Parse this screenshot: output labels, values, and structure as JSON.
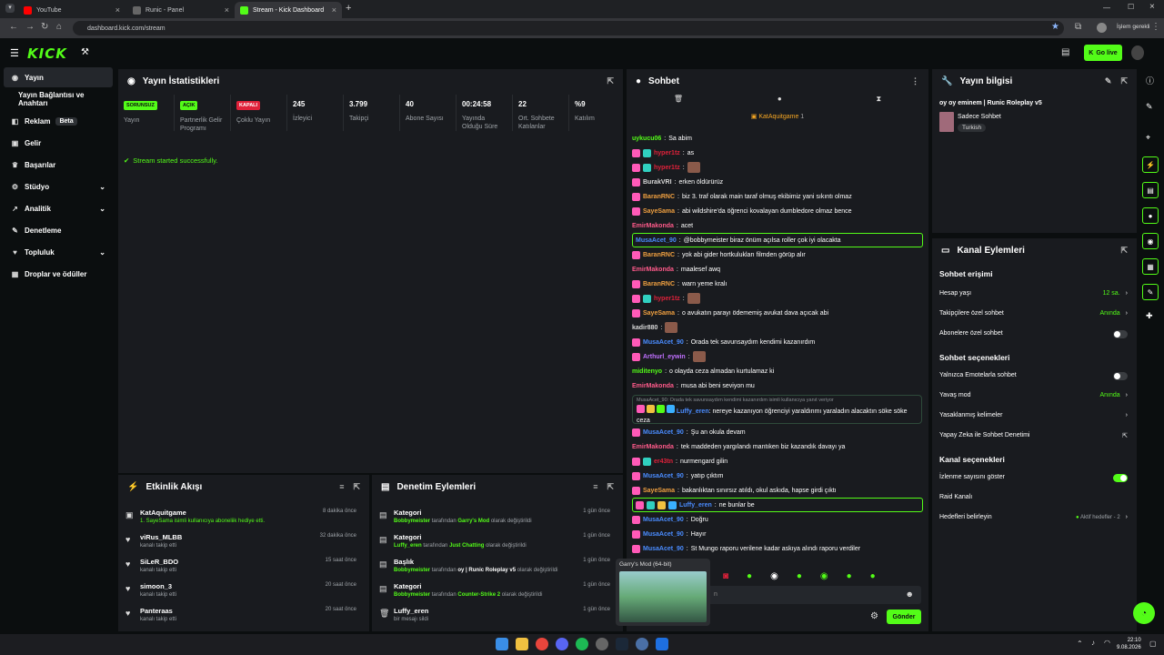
{
  "browser": {
    "tabs": [
      {
        "title": "YouTube",
        "color": "#ff0000"
      },
      {
        "title": "Runic - Panel",
        "color": "#888888"
      },
      {
        "title": "Stream - Kick Dashboard",
        "color": "#53fc18"
      }
    ],
    "url": "dashboard.kick.com/stream",
    "profile_label": "İşlem gerekli"
  },
  "topbar": {
    "logo": "KICK",
    "go_live": "Go live"
  },
  "sidebar": {
    "items": [
      {
        "label": "Yayın",
        "icon": "broadcast-icon"
      },
      {
        "label": "Yayın Bağlantısı ve Anahtarı",
        "icon": ""
      },
      {
        "label": "Reklam",
        "icon": "megaphone-icon",
        "badge": "Beta"
      },
      {
        "label": "Gelir",
        "icon": "money-icon"
      },
      {
        "label": "Başarılar",
        "icon": "trophy-icon"
      },
      {
        "label": "Stüdyo",
        "icon": "studio-icon"
      },
      {
        "label": "Analitik",
        "icon": "chart-icon"
      },
      {
        "label": "Denetleme",
        "icon": "shield-icon"
      },
      {
        "label": "Topluluk",
        "icon": "users-icon"
      },
      {
        "label": "Droplar ve ödüller",
        "icon": "gift-icon"
      }
    ]
  },
  "stats": {
    "title": "Yayın İstatistikleri",
    "items": [
      {
        "value": "SORUNSUZ",
        "label": "Yayın",
        "pill": "#53fc18",
        "pilltext": "#0b0e0f"
      },
      {
        "value": "AÇIK",
        "label": "Partnerlik Gelir Programı",
        "pill": "#53fc18",
        "pilltext": "#0b0e0f"
      },
      {
        "value": "KAPALI",
        "label": "Çoklu Yayın",
        "pill": "#e0213a",
        "pilltext": "#ffffff"
      },
      {
        "value": "245",
        "label": "İzleyici"
      },
      {
        "value": "3.799",
        "label": "Takipçi"
      },
      {
        "value": "40",
        "label": "Abone Sayısı"
      },
      {
        "value": "00:24:58",
        "label": "Yayında Olduğu Süre"
      },
      {
        "value": "22",
        "label": "Ort. Sohbete Katılanlar"
      },
      {
        "value": "%9",
        "label": "Katılım"
      }
    ],
    "success": "Stream started successfully."
  },
  "feed": {
    "title": "Etkinlik Akışı",
    "items": [
      {
        "name": "KatAquitgame",
        "sub": "1. SayeSama isimli kullanıcıya aboneliik hediye etti.",
        "time": "8 dakika önce",
        "icon": "gift-icon"
      },
      {
        "name": "viRus_MLBB",
        "sub": "kanalı takip etti",
        "time": "32 dakika önce",
        "icon": "heart-icon"
      },
      {
        "name": "SiLeR_BDO",
        "sub": "kanalı takip etti",
        "time": "15 saat önce",
        "icon": "heart-icon"
      },
      {
        "name": "simoon_3",
        "sub": "kanalı takip etti",
        "time": "20 saat önce",
        "icon": "heart-icon"
      },
      {
        "name": "Panteraas",
        "sub": "kanalı takip etti",
        "time": "20 saat önce",
        "icon": "heart-icon"
      }
    ]
  },
  "modlog": {
    "title": "Denetim Eylemleri",
    "items": [
      {
        "title": "Kategori",
        "user": "Bobbymeister",
        "mid": "tarafından",
        "val": "Garry's Mod",
        "end": "olarak değiştirildi",
        "time": "1 gün önce"
      },
      {
        "title": "Kategori",
        "user": "Luffy_eren",
        "mid": "tarafından",
        "val": "Just Chatting",
        "end": "olarak değiştirildi",
        "time": "1 gün önce"
      },
      {
        "title": "Başlık",
        "user": "Bobbymeister",
        "mid": "tarafından",
        "val": "oy | Runic Roleplay v5",
        "end": "olarak değiştirildi",
        "time": "1 gün önce"
      },
      {
        "title": "Kategori",
        "user": "Bobbymeister",
        "mid": "tarafından",
        "val": "Counter-Strike 2",
        "end": "olarak değiştirildi",
        "time": "1 gün önce"
      },
      {
        "title": "Luffy_eren",
        "user": "",
        "mid": "",
        "val": "",
        "end": "bir mesajı sildi",
        "time": "1 gün önce"
      }
    ]
  },
  "chat": {
    "title": "Sohbet",
    "pinned_user": "KatAquitgame",
    "pinned_count": "1",
    "messages": [
      {
        "user": "uykucu06",
        "color": "#53fc18",
        "text": "Sa abim",
        "badges": 0
      },
      {
        "user": "hyper1tz",
        "color": "#e0213a",
        "text": "as",
        "badges": 2
      },
      {
        "user": "hyper1tz",
        "color": "#e0213a",
        "text": "",
        "badges": 2,
        "emote": true
      },
      {
        "user": "BurakVRI",
        "color": "#d8d8d8",
        "text": "erken öldürürüz",
        "badges": 1
      },
      {
        "user": "BaranRNC",
        "color": "#f0a040",
        "text": "biz 3. traf olarak main taraf olmuş ekibimiz yani sıkıntı olmaz",
        "badges": 1
      },
      {
        "user": "SayeSama",
        "color": "#f0a040",
        "text": "abi wildshire'da öğrenci kovalayan dumbledore olmaz bence",
        "badges": 1
      },
      {
        "user": "EmirMakonda",
        "color": "#ff5a8a",
        "text": "acet",
        "badges": 0
      },
      {
        "user": "MusaAcet_90",
        "color": "#4a8cff",
        "text": "@bobbymeister biraz önüm açılsa roller çok iyi olacakta",
        "badges": 0,
        "highlight": true,
        "mention": "@bobbymeister"
      },
      {
        "user": "BaranRNC",
        "color": "#f0a040",
        "text": "yok abi gider hortkulukları filmden görüp alır",
        "badges": 1
      },
      {
        "user": "EmirMakonda",
        "color": "#ff5a8a",
        "text": "maalesef awq",
        "badges": 0
      },
      {
        "user": "BaranRNC",
        "color": "#f0a040",
        "text": "warn yeme kralı",
        "badges": 1
      },
      {
        "user": "hyper1tz",
        "color": "#e0213a",
        "text": "",
        "badges": 2,
        "emote": true
      },
      {
        "user": "SayeSama",
        "color": "#f0a040",
        "text": "o avukatın parayı ödememiş avukat dava açıcak abi",
        "badges": 1
      },
      {
        "user": "kadir880",
        "color": "#d8d8d8",
        "text": "",
        "badges": 0,
        "emote": true
      },
      {
        "user": "MusaAcet_90",
        "color": "#4a8cff",
        "text": "Orada tek savunsaydım kendimi kazanırdım",
        "badges": 1
      },
      {
        "user": "Arthurl_eywin",
        "color": "#c070ff",
        "text": "",
        "badges": 1,
        "emote": true
      },
      {
        "user": "miditenyo",
        "color": "#53fc18",
        "text": "o olayda ceza almadan kurtulamaz ki",
        "badges": 0
      },
      {
        "user": "EmirMakonda",
        "color": "#ff5a8a",
        "text": "musa abi beni seviyon mu",
        "badges": 0
      }
    ],
    "reply": {
      "quote": "MusaAcet_90: Orada tek savunsaydım kendimi kazanırdım isimli kullanıcıya yanıt veriyor",
      "user": "Luffy_eren",
      "text": "nereye kazanıyon öğrenciyi yaraldınmı yaraladın alacaktın söke söke ceza"
    },
    "messages2": [
      {
        "user": "MusaAcet_90",
        "color": "#4a8cff",
        "text": "Şu an okula devam",
        "badges": 1
      },
      {
        "user": "EmirMakonda",
        "color": "#ff5a8a",
        "text": "tek maddeden yargılandı mantıken biz kazandık davayı ya",
        "badges": 0
      },
      {
        "user": "er43tn",
        "color": "#e0213a",
        "text": "nurmengard gilin",
        "badges": 2
      },
      {
        "user": "MusaAcet_90",
        "color": "#4a8cff",
        "text": "yatıp çıktım",
        "badges": 1
      },
      {
        "user": "SayeSama",
        "color": "#f0a040",
        "text": "bakanlıktan sınırsız atıldı, okul askıda, hapse girdi çıktı",
        "badges": 1
      },
      {
        "user": "Luffy_eren",
        "color": "#4a8cff",
        "text": "ne bunlar be",
        "badges": 4,
        "highlight": true
      },
      {
        "user": "MusaAcet_90",
        "color": "#4a8cff",
        "text": "Doğru",
        "badges": 1
      },
      {
        "user": "MusaAcet_90",
        "color": "#4a8cff",
        "text": "Hayır",
        "badges": 1
      },
      {
        "user": "MusaAcet_90",
        "color": "#4a8cff",
        "text": "St Mungo raporu verilene kadar askıya alındı raporu verdiler",
        "badges": 1
      }
    ],
    "input_placeholder": "n",
    "send": "Gönder",
    "preview_title": "Garry's Mod (64-bit)"
  },
  "info": {
    "title": "Yayın bilgisi",
    "stream_title": "oy oy eminem | Runic Roleplay v5",
    "category": "Sadece Sohbet",
    "language": "Turkish"
  },
  "actions": {
    "title": "Kanal Eylemleri",
    "sec1": "Sohbet erişimi",
    "r1": {
      "label": "Hesap yaşı",
      "val": "12 sa."
    },
    "r2": {
      "label": "Takipçilere özel sohbet",
      "val": "Anında"
    },
    "r3": {
      "label": "Abonelere özel sohbet"
    },
    "sec2": "Sohbet seçenekleri",
    "r4": {
      "label": "Yalnızca Emotelarla sohbet"
    },
    "r5": {
      "label": "Yavaş mod",
      "val": "Anında"
    },
    "r6": {
      "label": "Yasaklanmış kelimeler"
    },
    "r7": {
      "label": "Yapay Zeka ile Sohbet Denetimi"
    },
    "sec3": "Kanal seçenekleri",
    "r8": {
      "label": "İzlenme sayısını göster"
    },
    "r9": {
      "label": "Raid Kanalı"
    },
    "r10": {
      "label": "Hedefleri belirleyin",
      "val": "Aktif hedefler - 2"
    }
  },
  "taskbar": {
    "time": "22:10",
    "date": "9.08.2026"
  }
}
